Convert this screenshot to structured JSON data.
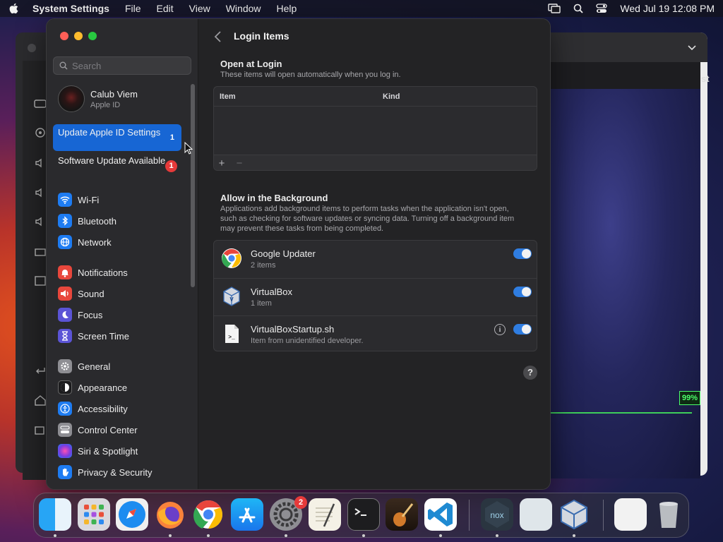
{
  "menubar": {
    "app_name": "System Settings",
    "menus": [
      "File",
      "Edit",
      "View",
      "Window",
      "Help"
    ],
    "datetime": "Wed Jul 19  12:08 PM"
  },
  "background_window": {
    "side_text": "st",
    "progress_label": "99%",
    "progress_value": 99
  },
  "sidebar": {
    "search_placeholder": "Search",
    "account": {
      "name": "Calub Viem",
      "sub": "Apple ID"
    },
    "notices": [
      {
        "label": "Update Apple ID Settings",
        "count": "1",
        "selected": true
      },
      {
        "label": "Software Update Available",
        "count": "1",
        "selected": false
      }
    ],
    "groups": [
      [
        {
          "label": "Wi-Fi",
          "icon": "wifi-icon",
          "color": "#1e7cf2"
        },
        {
          "label": "Bluetooth",
          "icon": "bluetooth-icon",
          "color": "#1e7cf2"
        },
        {
          "label": "Network",
          "icon": "network-globe-icon",
          "color": "#1e7cf2"
        }
      ],
      [
        {
          "label": "Notifications",
          "icon": "bell-icon",
          "color": "#e8473c"
        },
        {
          "label": "Sound",
          "icon": "speaker-icon",
          "color": "#e8473c"
        },
        {
          "label": "Focus",
          "icon": "moon-icon",
          "color": "#5b54d6"
        },
        {
          "label": "Screen Time",
          "icon": "hourglass-icon",
          "color": "#5b54d6"
        }
      ],
      [
        {
          "label": "General",
          "icon": "gear-icon",
          "color": "#8e8e93"
        },
        {
          "label": "Appearance",
          "icon": "appearance-icon",
          "color": "#1c1c1e"
        },
        {
          "label": "Accessibility",
          "icon": "accessibility-icon",
          "color": "#1e7cf2"
        },
        {
          "label": "Control Center",
          "icon": "control-center-icon",
          "color": "#8e8e93"
        },
        {
          "label": "Siri & Spotlight",
          "icon": "siri-icon",
          "color": "#b43fd0"
        },
        {
          "label": "Privacy & Security",
          "icon": "hand-icon",
          "color": "#1e7cf2"
        }
      ]
    ]
  },
  "content": {
    "title": "Login Items",
    "open_at_login": {
      "title": "Open at Login",
      "description": "These items will open automatically when you log in.",
      "columns": [
        "Item",
        "Kind"
      ],
      "add_label": "+",
      "remove_label": "−"
    },
    "background": {
      "title": "Allow in the Background",
      "description": "Applications add background items to perform tasks when the application isn't open, such as checking for software updates or syncing data. Turning off a background item may prevent these tasks from being completed.",
      "items": [
        {
          "name": "Google Updater",
          "sub": "2 items",
          "icon": "chrome-icon",
          "enabled": true
        },
        {
          "name": "VirtualBox",
          "sub": "1 item",
          "icon": "virtualbox-icon",
          "enabled": true
        },
        {
          "name": "VirtualBoxStartup.sh",
          "sub": "Item from unidentified developer.",
          "icon": "document-icon",
          "enabled": true,
          "info": "i"
        }
      ]
    },
    "help_label": "?"
  },
  "dock": {
    "settings_badge": "2",
    "apps": [
      "finder",
      "launchpad",
      "safari",
      "firefox",
      "chrome",
      "app-store",
      "system-settings",
      "textedit",
      "terminal",
      "garageband",
      "vscode",
      "nox",
      "preview",
      "virtualbox",
      "downloads",
      "trash"
    ]
  }
}
